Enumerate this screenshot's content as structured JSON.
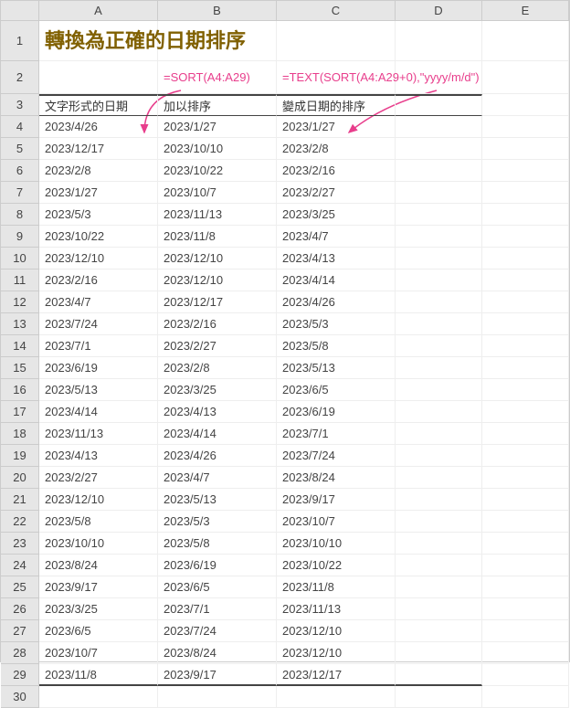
{
  "columns": [
    "",
    "A",
    "B",
    "C",
    "D",
    "E"
  ],
  "title": "轉換為正確的日期排序",
  "formula_b": "=SORT(A4:A29)",
  "formula_c": "=TEXT(SORT(A4:A29+0),\"yyyy/m/d\")",
  "header_a": "文字形式的日期",
  "header_b": "加以排序",
  "header_c": "變成日期的排序",
  "rows": [
    {
      "n": 4,
      "a": "2023/4/26",
      "b": "2023/1/27",
      "c": "2023/1/27"
    },
    {
      "n": 5,
      "a": "2023/12/17",
      "b": "2023/10/10",
      "c": "2023/2/8"
    },
    {
      "n": 6,
      "a": "2023/2/8",
      "b": "2023/10/22",
      "c": "2023/2/16"
    },
    {
      "n": 7,
      "a": "2023/1/27",
      "b": "2023/10/7",
      "c": "2023/2/27"
    },
    {
      "n": 8,
      "a": "2023/5/3",
      "b": "2023/11/13",
      "c": "2023/3/25"
    },
    {
      "n": 9,
      "a": "2023/10/22",
      "b": "2023/11/8",
      "c": "2023/4/7"
    },
    {
      "n": 10,
      "a": "2023/12/10",
      "b": "2023/12/10",
      "c": "2023/4/13"
    },
    {
      "n": 11,
      "a": "2023/2/16",
      "b": "2023/12/10",
      "c": "2023/4/14"
    },
    {
      "n": 12,
      "a": "2023/4/7",
      "b": "2023/12/17",
      "c": "2023/4/26"
    },
    {
      "n": 13,
      "a": "2023/7/24",
      "b": "2023/2/16",
      "c": "2023/5/3"
    },
    {
      "n": 14,
      "a": "2023/7/1",
      "b": "2023/2/27",
      "c": "2023/5/8"
    },
    {
      "n": 15,
      "a": "2023/6/19",
      "b": "2023/2/8",
      "c": "2023/5/13"
    },
    {
      "n": 16,
      "a": "2023/5/13",
      "b": "2023/3/25",
      "c": "2023/6/5"
    },
    {
      "n": 17,
      "a": "2023/4/14",
      "b": "2023/4/13",
      "c": "2023/6/19"
    },
    {
      "n": 18,
      "a": "2023/11/13",
      "b": "2023/4/14",
      "c": "2023/7/1"
    },
    {
      "n": 19,
      "a": "2023/4/13",
      "b": "2023/4/26",
      "c": "2023/7/24"
    },
    {
      "n": 20,
      "a": "2023/2/27",
      "b": "2023/4/7",
      "c": "2023/8/24"
    },
    {
      "n": 21,
      "a": "2023/12/10",
      "b": "2023/5/13",
      "c": "2023/9/17"
    },
    {
      "n": 22,
      "a": "2023/5/8",
      "b": "2023/5/3",
      "c": "2023/10/7"
    },
    {
      "n": 23,
      "a": "2023/10/10",
      "b": "2023/5/8",
      "c": "2023/10/10"
    },
    {
      "n": 24,
      "a": "2023/8/24",
      "b": "2023/6/19",
      "c": "2023/10/22"
    },
    {
      "n": 25,
      "a": "2023/9/17",
      "b": "2023/6/5",
      "c": "2023/11/8"
    },
    {
      "n": 26,
      "a": "2023/3/25",
      "b": "2023/7/1",
      "c": "2023/11/13"
    },
    {
      "n": 27,
      "a": "2023/6/5",
      "b": "2023/7/24",
      "c": "2023/12/10"
    },
    {
      "n": 28,
      "a": "2023/10/7",
      "b": "2023/8/24",
      "c": "2023/12/10"
    },
    {
      "n": 29,
      "a": "2023/11/8",
      "b": "2023/9/17",
      "c": "2023/12/17"
    }
  ],
  "last_row": 30,
  "chart_data": {
    "type": "table",
    "title": "轉換為正確的日期排序",
    "columns": [
      "文字形式的日期",
      "加以排序",
      "變成日期的排序"
    ],
    "data": [
      [
        "2023/4/26",
        "2023/1/27",
        "2023/1/27"
      ],
      [
        "2023/12/17",
        "2023/10/10",
        "2023/2/8"
      ],
      [
        "2023/2/8",
        "2023/10/22",
        "2023/2/16"
      ],
      [
        "2023/1/27",
        "2023/10/7",
        "2023/2/27"
      ],
      [
        "2023/5/3",
        "2023/11/13",
        "2023/3/25"
      ],
      [
        "2023/10/22",
        "2023/11/8",
        "2023/4/7"
      ],
      [
        "2023/12/10",
        "2023/12/10",
        "2023/4/13"
      ],
      [
        "2023/2/16",
        "2023/12/10",
        "2023/4/14"
      ],
      [
        "2023/4/7",
        "2023/12/17",
        "2023/4/26"
      ],
      [
        "2023/7/24",
        "2023/2/16",
        "2023/5/3"
      ],
      [
        "2023/7/1",
        "2023/2/27",
        "2023/5/8"
      ],
      [
        "2023/6/19",
        "2023/2/8",
        "2023/5/13"
      ],
      [
        "2023/5/13",
        "2023/3/25",
        "2023/6/5"
      ],
      [
        "2023/4/14",
        "2023/4/13",
        "2023/6/19"
      ],
      [
        "2023/11/13",
        "2023/4/14",
        "2023/7/1"
      ],
      [
        "2023/4/13",
        "2023/4/26",
        "2023/7/24"
      ],
      [
        "2023/2/27",
        "2023/4/7",
        "2023/8/24"
      ],
      [
        "2023/12/10",
        "2023/5/13",
        "2023/9/17"
      ],
      [
        "2023/5/8",
        "2023/5/3",
        "2023/10/7"
      ],
      [
        "2023/10/10",
        "2023/5/8",
        "2023/10/10"
      ],
      [
        "2023/8/24",
        "2023/6/19",
        "2023/10/22"
      ],
      [
        "2023/9/17",
        "2023/6/5",
        "2023/11/8"
      ],
      [
        "2023/3/25",
        "2023/7/1",
        "2023/11/13"
      ],
      [
        "2023/6/5",
        "2023/7/24",
        "2023/12/10"
      ],
      [
        "2023/10/7",
        "2023/8/24",
        "2023/12/10"
      ],
      [
        "2023/11/8",
        "2023/9/17",
        "2023/12/17"
      ]
    ]
  }
}
